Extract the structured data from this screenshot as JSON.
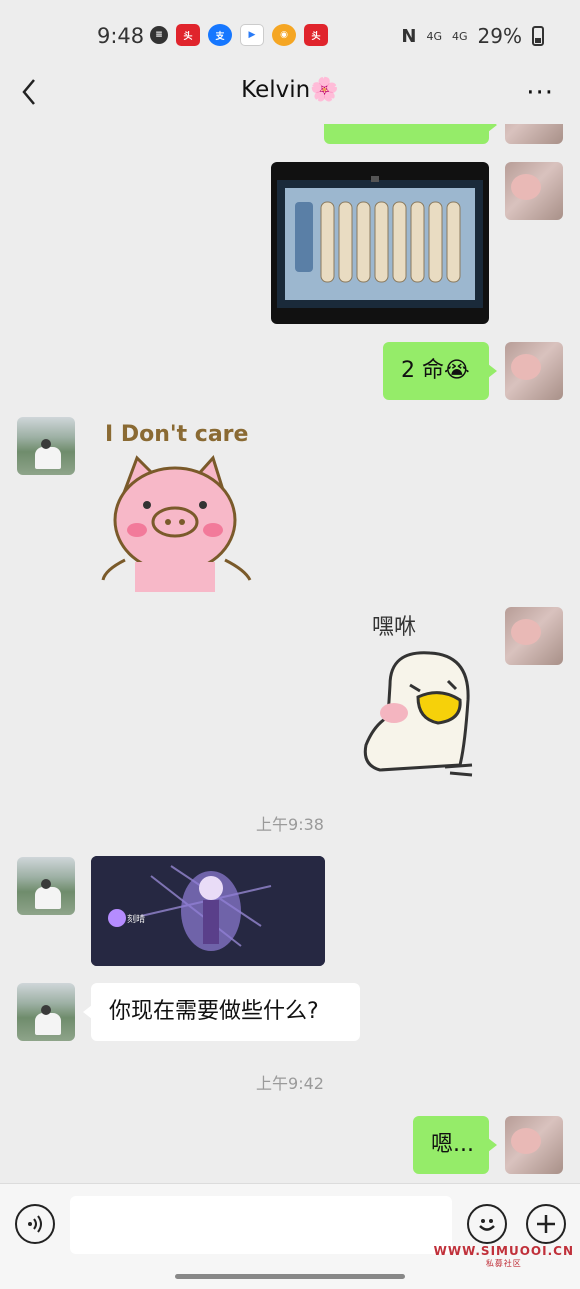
{
  "status_bar": {
    "time": "9:48",
    "network_1": "4G",
    "network_2": "4G",
    "battery": "29%",
    "app_icons": [
      "message-icon",
      "toutiao-icon",
      "alipay-icon",
      "youku-icon",
      "weibo-icon",
      "toutiao-icon"
    ]
  },
  "header": {
    "title": "Kelvin",
    "title_emoji": "🌸",
    "more_label": "···"
  },
  "messages": [
    {
      "side": "self",
      "type": "text",
      "text": "2 命",
      "emoji": "😭"
    },
    {
      "side": "other",
      "type": "sticker",
      "text": "I Don't care"
    },
    {
      "side": "self",
      "type": "sticker",
      "text": "嘿咻"
    },
    {
      "type": "timestamp",
      "text": "上午9:38"
    },
    {
      "side": "other",
      "type": "image"
    },
    {
      "side": "other",
      "type": "text",
      "text": "你现在需要做些什么?"
    },
    {
      "type": "timestamp",
      "text": "上午9:42"
    },
    {
      "side": "self",
      "type": "text",
      "text": "嗯..."
    }
  ],
  "game_card_label": "刻晴",
  "input_bar": {
    "voice_icon": "voice-icon",
    "emoji_icon": "smiley-icon",
    "plus_icon": "plus-icon"
  },
  "watermark": {
    "site": "WWW.SIMUOOI.CN",
    "sub": "私募社区"
  },
  "colors": {
    "self_bubble": "#95ec69",
    "other_bubble": "#ffffff",
    "background": "#ededed"
  }
}
